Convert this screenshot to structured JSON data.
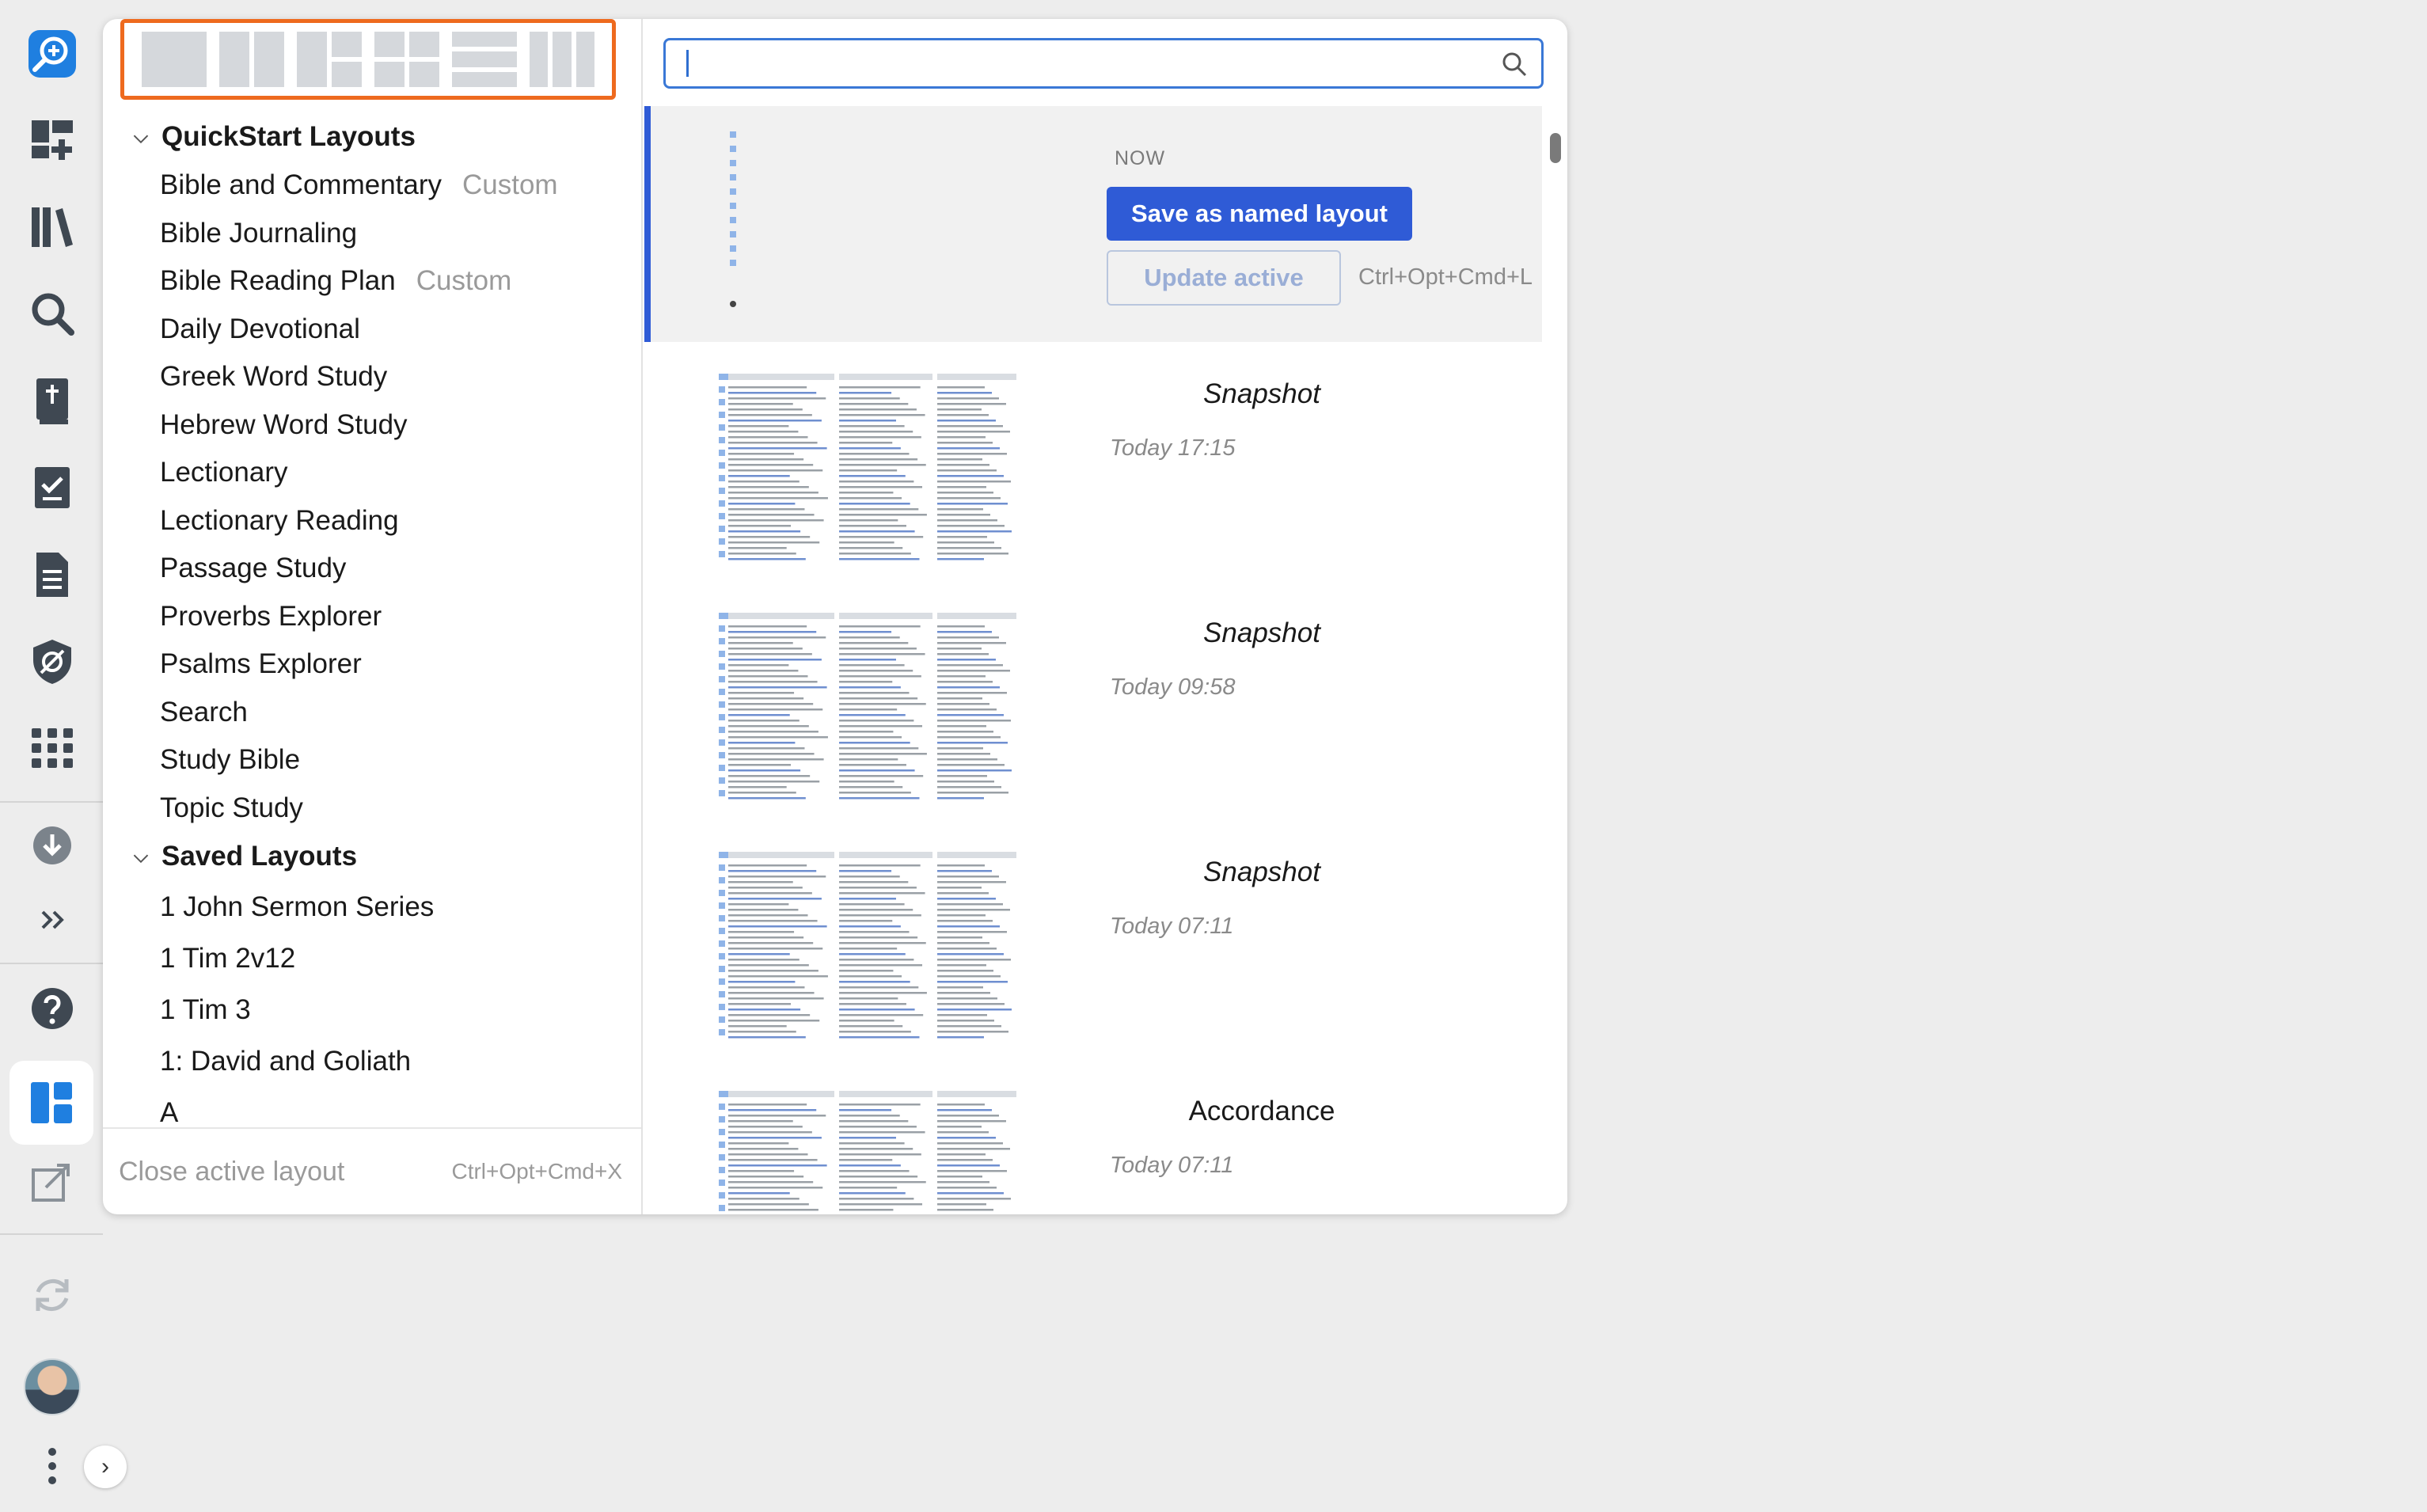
{
  "rail": {
    "icons": [
      "app-logo-search",
      "dashboard-add",
      "library",
      "search",
      "bible",
      "checklist",
      "document",
      "shield-eye",
      "apps-grid",
      "download",
      "more-chevrons",
      "help",
      "layouts",
      "close-panels",
      "sync",
      "user-avatar",
      "more-vertical",
      "expand"
    ]
  },
  "layout_picker": {
    "options": [
      "single-panel",
      "two-columns",
      "three-panels",
      "four-grid",
      "rows",
      "three-columns"
    ]
  },
  "tree": {
    "quickstart": {
      "title": "QuickStart Layouts",
      "items": [
        {
          "label": "Bible and Commentary",
          "tag": "Custom"
        },
        {
          "label": "Bible Journaling",
          "tag": ""
        },
        {
          "label": "Bible Reading Plan",
          "tag": "Custom"
        },
        {
          "label": "Daily Devotional",
          "tag": ""
        },
        {
          "label": "Greek Word Study",
          "tag": ""
        },
        {
          "label": "Hebrew Word Study",
          "tag": ""
        },
        {
          "label": "Lectionary",
          "tag": ""
        },
        {
          "label": "Lectionary Reading",
          "tag": ""
        },
        {
          "label": "Passage Study",
          "tag": ""
        },
        {
          "label": "Proverbs Explorer",
          "tag": ""
        },
        {
          "label": "Psalms Explorer",
          "tag": ""
        },
        {
          "label": "Search",
          "tag": ""
        },
        {
          "label": "Study Bible",
          "tag": ""
        },
        {
          "label": "Topic Study",
          "tag": ""
        }
      ]
    },
    "saved": {
      "title": "Saved Layouts",
      "items": [
        "1 John Sermon Series",
        "1 Tim 2v12",
        "1 Tim 3",
        "1: David and Goliath",
        "A"
      ]
    }
  },
  "footer": {
    "close_label": "Close active layout",
    "close_shortcut": "Ctrl+Opt+Cmd+X"
  },
  "search": {
    "value": "",
    "placeholder": ""
  },
  "now": {
    "label": "NOW",
    "save_label": "Save as named layout",
    "update_label": "Update active",
    "update_shortcut": "Ctrl+Opt+Cmd+L"
  },
  "snapshots": [
    {
      "name": "Snapshot",
      "time": "Today 17:15"
    },
    {
      "name": "Snapshot",
      "time": "Today 09:58"
    },
    {
      "name": "Snapshot",
      "time": "Today 07:11"
    },
    {
      "name": "Accordance",
      "time": "Today 07:11"
    }
  ],
  "colors": {
    "accent": "#2f5bd6",
    "picker_border": "#ee6a1e",
    "logo_blue": "#1f7fe0"
  }
}
